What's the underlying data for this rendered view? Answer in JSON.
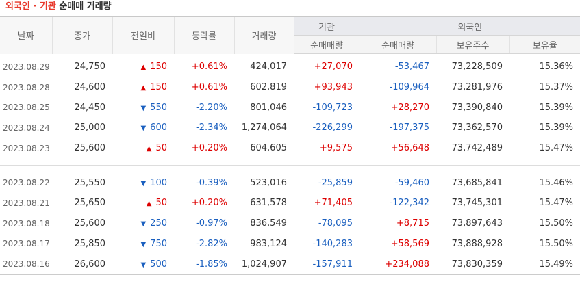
{
  "title": {
    "part1": "외국인 · 기관",
    "part2": "순매매 거래량"
  },
  "headers": {
    "date": "날짜",
    "close": "종가",
    "change": "전일비",
    "rate": "등락률",
    "volume": "거래량",
    "inst_group": "기관",
    "foreign_group": "외국인",
    "inst_net": "순매매량",
    "foreign_net": "순매매량",
    "holdings": "보유주수",
    "ratio": "보유율"
  },
  "rows_group1": [
    {
      "date": "2023.08.29",
      "close": "24,750",
      "dir": "up",
      "change": "150",
      "rate": "+0.61%",
      "volume": "424,017",
      "inst": "+27,070",
      "inst_dir": "up",
      "foreign": "-53,467",
      "foreign_dir": "down",
      "holdings": "73,228,509",
      "ratio": "15.36%"
    },
    {
      "date": "2023.08.28",
      "close": "24,600",
      "dir": "up",
      "change": "150",
      "rate": "+0.61%",
      "volume": "602,819",
      "inst": "+93,943",
      "inst_dir": "up",
      "foreign": "-109,964",
      "foreign_dir": "down",
      "holdings": "73,281,976",
      "ratio": "15.37%"
    },
    {
      "date": "2023.08.25",
      "close": "24,450",
      "dir": "down",
      "change": "550",
      "rate": "-2.20%",
      "volume": "801,046",
      "inst": "-109,723",
      "inst_dir": "down",
      "foreign": "+28,270",
      "foreign_dir": "up",
      "holdings": "73,390,840",
      "ratio": "15.39%"
    },
    {
      "date": "2023.08.24",
      "close": "25,000",
      "dir": "down",
      "change": "600",
      "rate": "-2.34%",
      "volume": "1,274,064",
      "inst": "-226,299",
      "inst_dir": "down",
      "foreign": "-197,375",
      "foreign_dir": "down",
      "holdings": "73,362,570",
      "ratio": "15.39%"
    },
    {
      "date": "2023.08.23",
      "close": "25,600",
      "dir": "up",
      "change": "50",
      "rate": "+0.20%",
      "volume": "604,605",
      "inst": "+9,575",
      "inst_dir": "up",
      "foreign": "+56,648",
      "foreign_dir": "up",
      "holdings": "73,742,489",
      "ratio": "15.47%"
    }
  ],
  "rows_group2": [
    {
      "date": "2023.08.22",
      "close": "25,550",
      "dir": "down",
      "change": "100",
      "rate": "-0.39%",
      "volume": "523,016",
      "inst": "-25,859",
      "inst_dir": "down",
      "foreign": "-59,460",
      "foreign_dir": "down",
      "holdings": "73,685,841",
      "ratio": "15.46%"
    },
    {
      "date": "2023.08.21",
      "close": "25,650",
      "dir": "up",
      "change": "50",
      "rate": "+0.20%",
      "volume": "631,578",
      "inst": "+71,405",
      "inst_dir": "up",
      "foreign": "-122,342",
      "foreign_dir": "down",
      "holdings": "73,745,301",
      "ratio": "15.47%"
    },
    {
      "date": "2023.08.18",
      "close": "25,600",
      "dir": "down",
      "change": "250",
      "rate": "-0.97%",
      "volume": "836,549",
      "inst": "-78,095",
      "inst_dir": "down",
      "foreign": "+8,715",
      "foreign_dir": "up",
      "holdings": "73,897,643",
      "ratio": "15.50%"
    },
    {
      "date": "2023.08.17",
      "close": "25,850",
      "dir": "down",
      "change": "750",
      "rate": "-2.82%",
      "volume": "983,124",
      "inst": "-140,283",
      "inst_dir": "down",
      "foreign": "+58,569",
      "foreign_dir": "up",
      "holdings": "73,888,928",
      "ratio": "15.50%"
    },
    {
      "date": "2023.08.16",
      "close": "26,600",
      "dir": "down",
      "change": "500",
      "rate": "-1.85%",
      "volume": "1,024,907",
      "inst": "-157,911",
      "inst_dir": "down",
      "foreign": "+234,088",
      "foreign_dir": "up",
      "holdings": "73,830,359",
      "ratio": "15.49%"
    }
  ],
  "colors": {
    "up": "#dd0000",
    "down": "#1a5fbf",
    "title_accent": "#e8382b"
  }
}
